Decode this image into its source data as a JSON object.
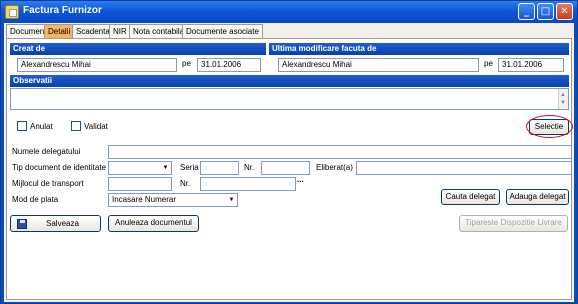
{
  "window": {
    "title": "Factura Furnizor",
    "minimize": "_",
    "maximize": "□",
    "close": "✕"
  },
  "tabs": [
    "Document",
    "Detalii",
    "Scadenta",
    "NIR",
    "Nota contabila",
    "Documente asociate"
  ],
  "active_tab": "Detalii",
  "created": {
    "header": "Creat de",
    "user": "Alexandrescu Mihai",
    "pe_label": "pe",
    "date": "31.01.2006"
  },
  "modified": {
    "header": "Ultima modificare facuta de",
    "user": "Alexandrescu Mihai",
    "pe_label": "pe",
    "date": "31.01.2006"
  },
  "observations": {
    "header": "Observatii",
    "value": ""
  },
  "checkboxes": {
    "anulat": "Anulat",
    "validat": "Validat"
  },
  "buttons": {
    "selectie": "Selectie",
    "cauta_delegat": "Cauta delegat",
    "adauga_delegat": "Adauga delegat",
    "salveaza": "Salveaza",
    "anuleaza": "Anuleaza documentul",
    "tipareste": "Tipareste Dispozitie Livrare"
  },
  "form": {
    "numele_delegatului": "Numele delegatului",
    "tip_document": "Tip document de identitate",
    "seria": "Seria",
    "nr": "Nr.",
    "eliberat": "Eliberat(a)",
    "mijlocul": "Mijlocul de transport",
    "nr2": "Nr.",
    "mod_plata": "Mod de plata",
    "mod_plata_value": "Incasare Numerar",
    "ellipsis": "..."
  },
  "icons": {
    "window_icon": "document-icon",
    "save_icon": "floppy-disk-icon"
  }
}
